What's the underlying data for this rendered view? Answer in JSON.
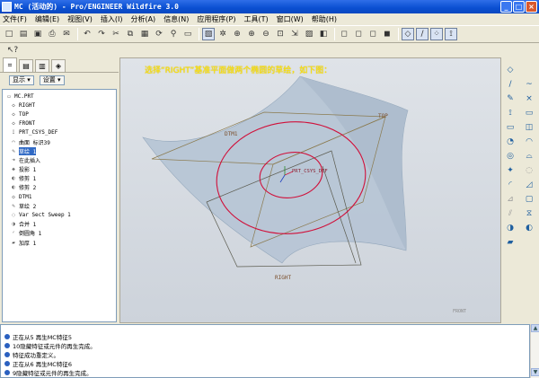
{
  "window": {
    "title": "MC (活动的) - Pro/ENGINEER Wildfire 3.0",
    "buttons": [
      "_",
      "□",
      "×"
    ]
  },
  "menu": [
    "文件(F)",
    "编辑(E)",
    "视图(V)",
    "插入(I)",
    "分析(A)",
    "信息(N)",
    "应用程序(P)",
    "工具(T)",
    "窗口(W)",
    "帮助(H)"
  ],
  "toolbar": {
    "icons": [
      "new-file",
      "open-file",
      "save",
      "print",
      "email",
      "undo",
      "redo",
      "cut",
      "copy",
      "paste",
      "regenerate",
      "find",
      "select-box",
      "repaint",
      "spin-center",
      "orient",
      "zoom-in",
      "zoom-out",
      "refit",
      "reorient",
      "saved-views",
      "layers",
      "wireframe",
      "hidden-line",
      "no-hidden",
      "shading",
      "datum-planes",
      "datum-axes",
      "datum-points",
      "coord-systems"
    ]
  },
  "panel": {
    "show_label": "显示",
    "settings_label": "设置"
  },
  "tree": [
    {
      "icon": "part",
      "label": "MC.PRT"
    },
    {
      "icon": "plane",
      "label": "RIGHT"
    },
    {
      "icon": "plane",
      "label": "TOP"
    },
    {
      "icon": "plane",
      "label": "FRONT"
    },
    {
      "icon": "csys",
      "label": "PRT_CSYS_DEF"
    },
    {
      "icon": "surface",
      "label": "曲面 标识39"
    },
    {
      "icon": "sketch",
      "label": "草绘 1"
    },
    {
      "icon": "insert",
      "label": "在此插入"
    },
    {
      "icon": "projection",
      "label": "投影 1"
    },
    {
      "icon": "trim",
      "label": "修剪 1"
    },
    {
      "icon": "trim",
      "label": "修剪 2"
    },
    {
      "icon": "plane",
      "label": "DTM1"
    },
    {
      "icon": "sketch",
      "label": "草绘 2"
    },
    {
      "icon": "sweep",
      "label": "Var Sect Sweep 1"
    },
    {
      "icon": "merge",
      "label": "合并 1"
    },
    {
      "icon": "round",
      "label": "倒圆角 1"
    },
    {
      "icon": "thicken",
      "label": "加厚 1"
    }
  ],
  "selected_tree_index": 6,
  "graphics": {
    "instruction": "选择“RIGHT”基准平面做两个椭圆的草绘，如下图：",
    "labels": {
      "dtm1": "DTM1",
      "top": "TOP",
      "csys": "PRT_CSYS_DEF",
      "right": "RIGHT",
      "front": "FRONT"
    },
    "colors": {
      "ellipse": "#d0103a",
      "plane": "#8a7a4e",
      "surface": "#b8c6d6",
      "instruction": "#ffe600"
    }
  },
  "right_toolbar": [
    "datum-plane",
    "datum-axis",
    "datum-curve",
    "sketch-tool",
    "datum-point",
    "coord-sys",
    "analysis",
    "insert-mode",
    "extrude",
    "revolve",
    "variable-sweep",
    "blend",
    "boundary-blend",
    "style",
    "hole",
    "round",
    "edge-chamfer",
    "draft",
    "shell",
    "rib",
    "mirror",
    "merge",
    "trim",
    "offset",
    "thicken"
  ],
  "messages": [
    "正在从5 再生MC特征5",
    "10隐藏特征或元件的再生完成。",
    "特征成功重定义。",
    "正在从6 再生MC特征6",
    "9隐藏特征或元件的再生完成。"
  ]
}
